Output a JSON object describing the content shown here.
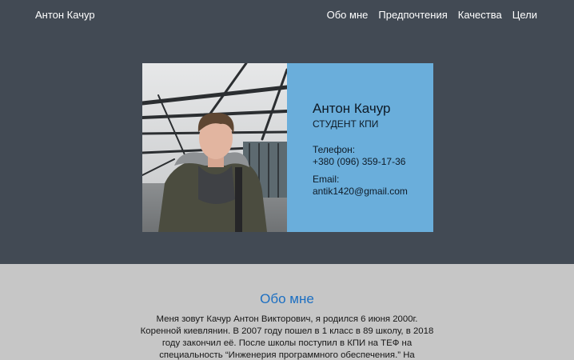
{
  "header": {
    "brand": "Антон Качур",
    "nav": [
      "Обо мне",
      "Предпочтения",
      "Качества",
      "Цели"
    ]
  },
  "card": {
    "name": "Антон Качур",
    "role": "СТУДЕНТ КПИ",
    "phone_label": "Телефон:",
    "phone": "+380 (096) 359-17-36",
    "email_label": "Email:",
    "email": "antik1420@gmail.com"
  },
  "about": {
    "title": "Обо мне",
    "text": "Меня зовут Качур Антон Викторович, я родился 6 июня 2000г. Коренной киевлянин. В 2007 году пошел в 1 класс в 89 школу, в 2018 году закончил её. После школы поступил в КПИ на ТЕФ на специальность “Инженерия программного обеспечения.” На"
  },
  "colors": {
    "header_bg": "#424a54",
    "card_info_bg": "#6aaedb",
    "about_bg": "#c6c6c6",
    "about_title": "#1c6fc2"
  }
}
